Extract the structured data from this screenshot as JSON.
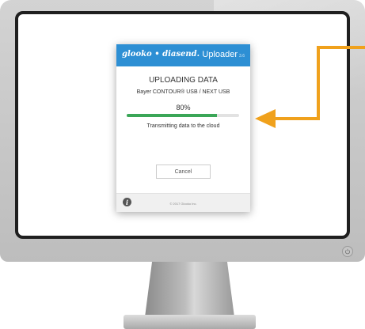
{
  "dialog": {
    "brand": "glooko • diasend.",
    "app_name": "Uploader",
    "version": "3.6",
    "status_title": "UPLOADING DATA",
    "device": "Bayer CONTOUR® USB / NEXT USB",
    "progress_percent": 80,
    "progress_label": "80%",
    "status_message": "Transmitting data to the cloud",
    "cancel_label": "Cancel",
    "copyright": "© 2017 Glooko Inc."
  },
  "colors": {
    "header": "#2d8fd4",
    "progress": "#3aa657",
    "arrow": "#f0a11c"
  }
}
